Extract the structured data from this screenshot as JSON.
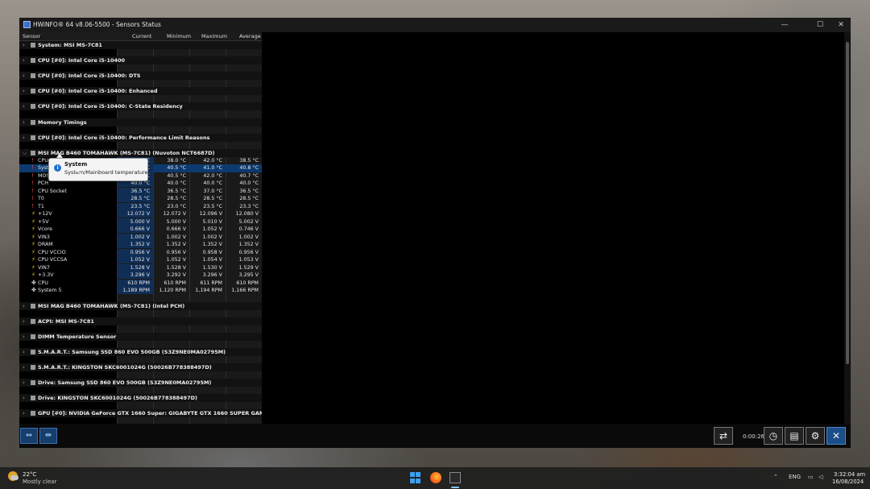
{
  "window": {
    "title": "HWiNFO® 64 v8.06-5500 - Sensors Status"
  },
  "controls": {
    "minimize": "—",
    "maximize": "☐",
    "close": "✕"
  },
  "columns": [
    "Sensor",
    "Current",
    "Minimum",
    "Maximum",
    "Average"
  ],
  "groups_top": [
    "System: MSI MS-7C81",
    "CPU [#0]: Intel Core i5-10400",
    "CPU [#0]: Intel Core i5-10400: DTS",
    "CPU [#0]: Intel Core i5-10400: Enhanced",
    "CPU [#0]: Intel Core i5-10400: C-State Residency",
    "Memory Timings",
    "CPU [#0]: Intel Core i5-10400: Performance Limit Reasons"
  ],
  "expanded_group": "MSI MAG B460 TOMAHAWK (MS-7C81) (Nuvoton NCT6687D)",
  "rows": [
    {
      "name": "CPU",
      "cur": "38.0 °C",
      "min": "38.0 °C",
      "max": "42.0 °C",
      "avg": "38.5 °C",
      "kind": "temp"
    },
    {
      "name": "System",
      "cur": "40.5 °C",
      "min": "40.5 °C",
      "max": "41.0 °C",
      "avg": "40.8 °C",
      "kind": "temp"
    },
    {
      "name": "MOS",
      "cur": "40.5 °C",
      "min": "40.5 °C",
      "max": "42.0 °C",
      "avg": "40.7 °C",
      "kind": "temp"
    },
    {
      "name": "PCH",
      "cur": "40.0 °C",
      "min": "40.0 °C",
      "max": "40.0 °C",
      "avg": "40.0 °C",
      "kind": "temp"
    },
    {
      "name": "CPU Socket",
      "cur": "36.5 °C",
      "min": "36.5 °C",
      "max": "37.0 °C",
      "avg": "36.5 °C",
      "kind": "temp"
    },
    {
      "name": "T0",
      "cur": "28.5 °C",
      "min": "28.5 °C",
      "max": "28.5 °C",
      "avg": "28.5 °C",
      "kind": "temp"
    },
    {
      "name": "T1",
      "cur": "23.5 °C",
      "min": "23.0 °C",
      "max": "23.5 °C",
      "avg": "23.3 °C",
      "kind": "temp"
    },
    {
      "name": "+12V",
      "cur": "12.072 V",
      "min": "12.072 V",
      "max": "12.096 V",
      "avg": "12.080 V",
      "kind": "volt"
    },
    {
      "name": "+5V",
      "cur": "5.000 V",
      "min": "5.000 V",
      "max": "5.010 V",
      "avg": "5.002 V",
      "kind": "volt"
    },
    {
      "name": "Vcore",
      "cur": "0.666 V",
      "min": "0.666 V",
      "max": "1.052 V",
      "avg": "0.746 V",
      "kind": "volt"
    },
    {
      "name": "VIN3",
      "cur": "1.002 V",
      "min": "1.002 V",
      "max": "1.002 V",
      "avg": "1.002 V",
      "kind": "volt"
    },
    {
      "name": "DRAM",
      "cur": "1.352 V",
      "min": "1.352 V",
      "max": "1.352 V",
      "avg": "1.352 V",
      "kind": "volt"
    },
    {
      "name": "CPU VCCIO",
      "cur": "0.956 V",
      "min": "0.956 V",
      "max": "0.958 V",
      "avg": "0.956 V",
      "kind": "volt"
    },
    {
      "name": "CPU VCCSA",
      "cur": "1.052 V",
      "min": "1.052 V",
      "max": "1.054 V",
      "avg": "1.053 V",
      "kind": "volt"
    },
    {
      "name": "VIN7",
      "cur": "1.528 V",
      "min": "1.528 V",
      "max": "1.530 V",
      "avg": "1.529 V",
      "kind": "volt"
    },
    {
      "name": "+3.3V",
      "cur": "3.296 V",
      "min": "3.292 V",
      "max": "3.296 V",
      "avg": "3.295 V",
      "kind": "volt"
    },
    {
      "name": "CPU",
      "cur": "610 RPM",
      "min": "610 RPM",
      "max": "611 RPM",
      "avg": "610 RPM",
      "kind": "fan"
    },
    {
      "name": "System 5",
      "cur": "1,189 RPM",
      "min": "1,120 RPM",
      "max": "1,194 RPM",
      "avg": "1,166 RPM",
      "kind": "fan"
    }
  ],
  "groups_bottom": [
    "MSI MAG B460 TOMAHAWK (MS-7C81) (Intel PCH)",
    "ACPI: MSI MS-7C81",
    "DIMM Temperature Sensor",
    "S.M.A.R.T.: Samsung SSD 860 EVO 500GB (S3Z9NE0MA02795M)",
    "S.M.A.R.T.: KINGSTON SKC6001024G (50026B778388497D)",
    "Drive: Samsung SSD 860 EVO 500GB (S3Z9NE0MA02795M)",
    "Drive: KINGSTON SKC6001024G (50026B778388497D)",
    "GPU [#0]: NVIDIA GeForce GTX 1660 Super: GIGABYTE GTX 1660 SUPER GAMING OC 6G ..."
  ],
  "tooltip": {
    "title": "System",
    "description": "System/Mainboard temperature."
  },
  "toolbar": {
    "timer": "0:00:26"
  },
  "taskbar": {
    "temp": "22°C",
    "condition": "Mostly clear",
    "lang": "ENG",
    "time": "3:32:04 am",
    "date": "16/08/2024"
  }
}
